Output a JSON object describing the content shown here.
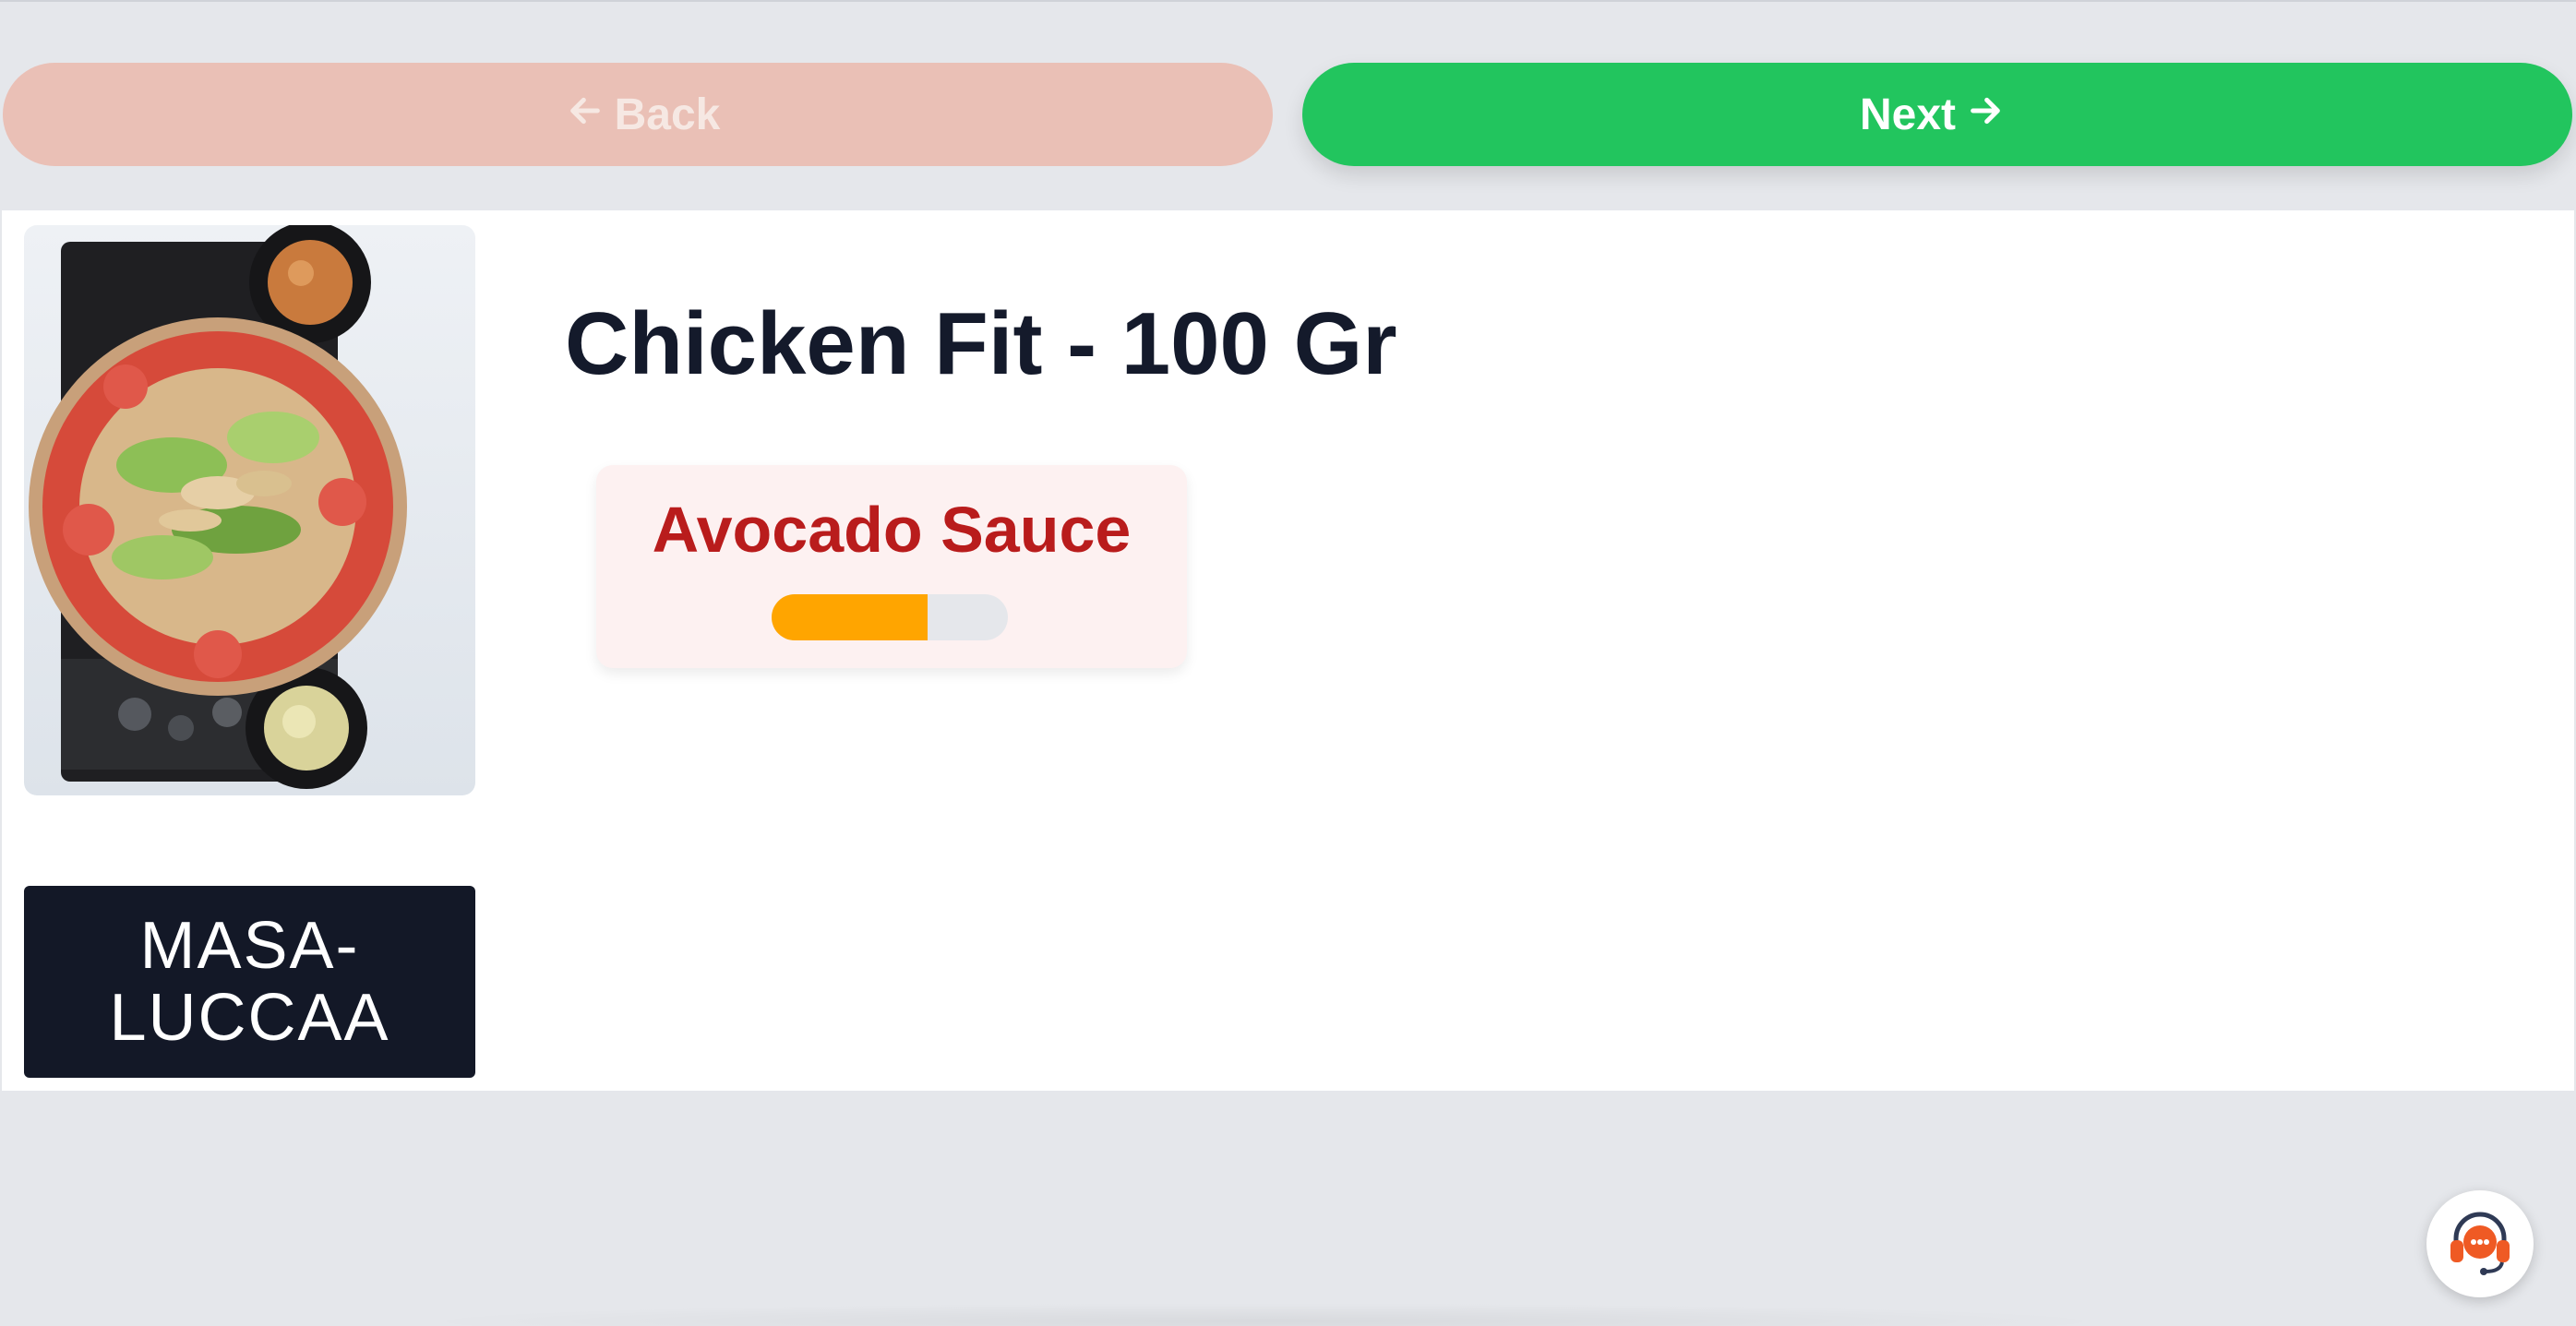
{
  "nav": {
    "back_label": "Back",
    "next_label": "Next",
    "back_icon": "arrow-left-icon",
    "next_icon": "arrow-right-icon"
  },
  "product": {
    "title": "Chicken Fit - 100 Gr",
    "image_icon": "salad-bowl-image"
  },
  "option": {
    "name": "Avocado Sauce",
    "progress_fraction": 0.66,
    "progress_color": "#ffa500"
  },
  "brand": {
    "line1": "MASA-",
    "line2": "LUCCAA"
  },
  "support": {
    "icon": "headset-support-icon"
  },
  "colors": {
    "next_button": "#22c55e",
    "back_button": "#eac0b6",
    "option_title": "#b91c1c",
    "brand_bg": "#131827"
  }
}
